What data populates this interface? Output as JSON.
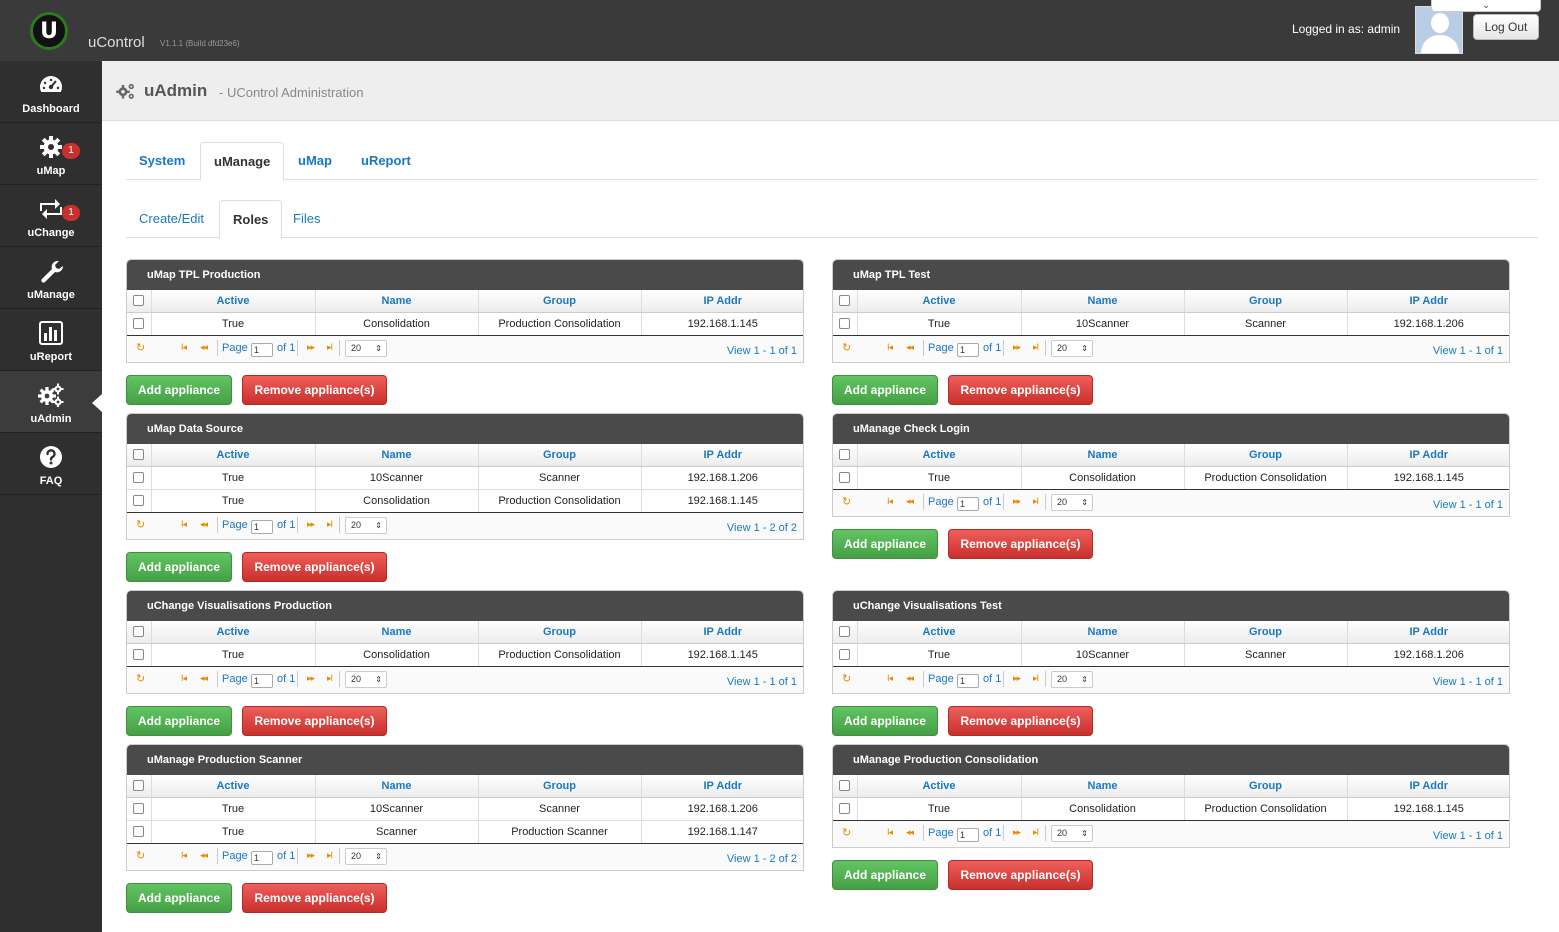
{
  "app": {
    "brand": "uControl",
    "version": "V1.1.1 (Build dfd23e6)",
    "logged_in": "Logged in as: admin",
    "logout": "Log Out",
    "dropdown_glyph": "⌄"
  },
  "sidebar": {
    "items": [
      {
        "label": "Dashboard",
        "icon": "dashboard-icon"
      },
      {
        "label": "uMap",
        "icon": "gear-icon",
        "badge": "1"
      },
      {
        "label": "uChange",
        "icon": "retweet-icon",
        "badge": "1"
      },
      {
        "label": "uManage",
        "icon": "wrench-icon"
      },
      {
        "label": "uReport",
        "icon": "bar-chart-icon"
      },
      {
        "label": "uAdmin",
        "icon": "gears-icon"
      },
      {
        "label": "FAQ",
        "icon": "question-icon"
      }
    ]
  },
  "page": {
    "title": "uAdmin",
    "subtitle": "- UControl Administration"
  },
  "tabs": [
    "System",
    "uManage",
    "uMap",
    "uReport"
  ],
  "subtabs": [
    "Create/Edit",
    "Roles",
    "Files"
  ],
  "columns": [
    "Active",
    "Name",
    "Group",
    "IP Addr"
  ],
  "pager": {
    "page_label": "Page",
    "page_value": "1",
    "rows": "20",
    "refresh_icon": "↻",
    "first": "I◂",
    "prev": "◂◂",
    "next": "▸▸",
    "last": "▸I",
    "rows_arrow": "⇕"
  },
  "buttons": {
    "add": "Add appliance",
    "remove": "Remove appliance(s)"
  },
  "grids": [
    {
      "title": "uMap TPL Production",
      "rows": [
        [
          "True",
          "Consolidation",
          "Production Consolidation",
          "192.168.1.145"
        ]
      ],
      "of": "of 1",
      "view": "View 1 - 1 of 1"
    },
    {
      "title": "uMap TPL Test",
      "rows": [
        [
          "True",
          "10Scanner",
          "Scanner",
          "192.168.1.206"
        ]
      ],
      "of": "of 1",
      "view": "View 1 - 1 of 1"
    },
    {
      "title": "uMap Data Source",
      "rows": [
        [
          "True",
          "10Scanner",
          "Scanner",
          "192.168.1.206"
        ],
        [
          "True",
          "Consolidation",
          "Production Consolidation",
          "192.168.1.145"
        ]
      ],
      "of": "of 1",
      "view": "View 1 - 2 of 2"
    },
    {
      "title": "uManage Check Login",
      "rows": [
        [
          "True",
          "Consolidation",
          "Production Consolidation",
          "192.168.1.145"
        ]
      ],
      "of": "of 1",
      "view": "View 1 - 1 of 1"
    },
    {
      "title": "uChange Visualisations Production",
      "rows": [
        [
          "True",
          "Consolidation",
          "Production Consolidation",
          "192.168.1.145"
        ]
      ],
      "of": "of 1",
      "view": "View 1 - 1 of 1"
    },
    {
      "title": "uChange Visualisations Test",
      "rows": [
        [
          "True",
          "10Scanner",
          "Scanner",
          "192.168.1.206"
        ]
      ],
      "of": "of 1",
      "view": "View 1 - 1 of 1"
    },
    {
      "title": "uManage Production Scanner",
      "rows": [
        [
          "True",
          "10Scanner",
          "Scanner",
          "192.168.1.206"
        ],
        [
          "True",
          "Scanner",
          "Production Scanner",
          "192.168.1.147"
        ]
      ],
      "of": "of 1",
      "view": "View 1 - 2 of 2"
    },
    {
      "title": "uManage Production Consolidation",
      "rows": [
        [
          "True",
          "Consolidation",
          "Production Consolidation",
          "192.168.1.145"
        ]
      ],
      "of": "of 1",
      "view": "View 1 - 1 of 1"
    }
  ]
}
